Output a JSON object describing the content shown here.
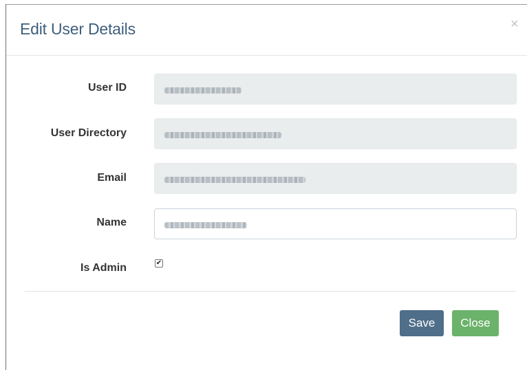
{
  "dialog": {
    "title": "Edit User Details",
    "close_glyph": "×"
  },
  "form": {
    "user_id_label": "User ID",
    "user_directory_label": "User Directory",
    "email_label": "Email",
    "name_label": "Name",
    "is_admin_label": "Is Admin",
    "is_admin_checked": true,
    "checkmark_glyph": "✔"
  },
  "buttons": {
    "save_label": "Save",
    "close_label": "Close"
  },
  "colors": {
    "title": "#3f5f7d",
    "save_button": "#4e6e8a",
    "close_button": "#6bb26a",
    "readonly_field": "#eaedee"
  },
  "icons": {
    "close": "close-icon",
    "checkbox": "checkbox-checked-icon"
  }
}
